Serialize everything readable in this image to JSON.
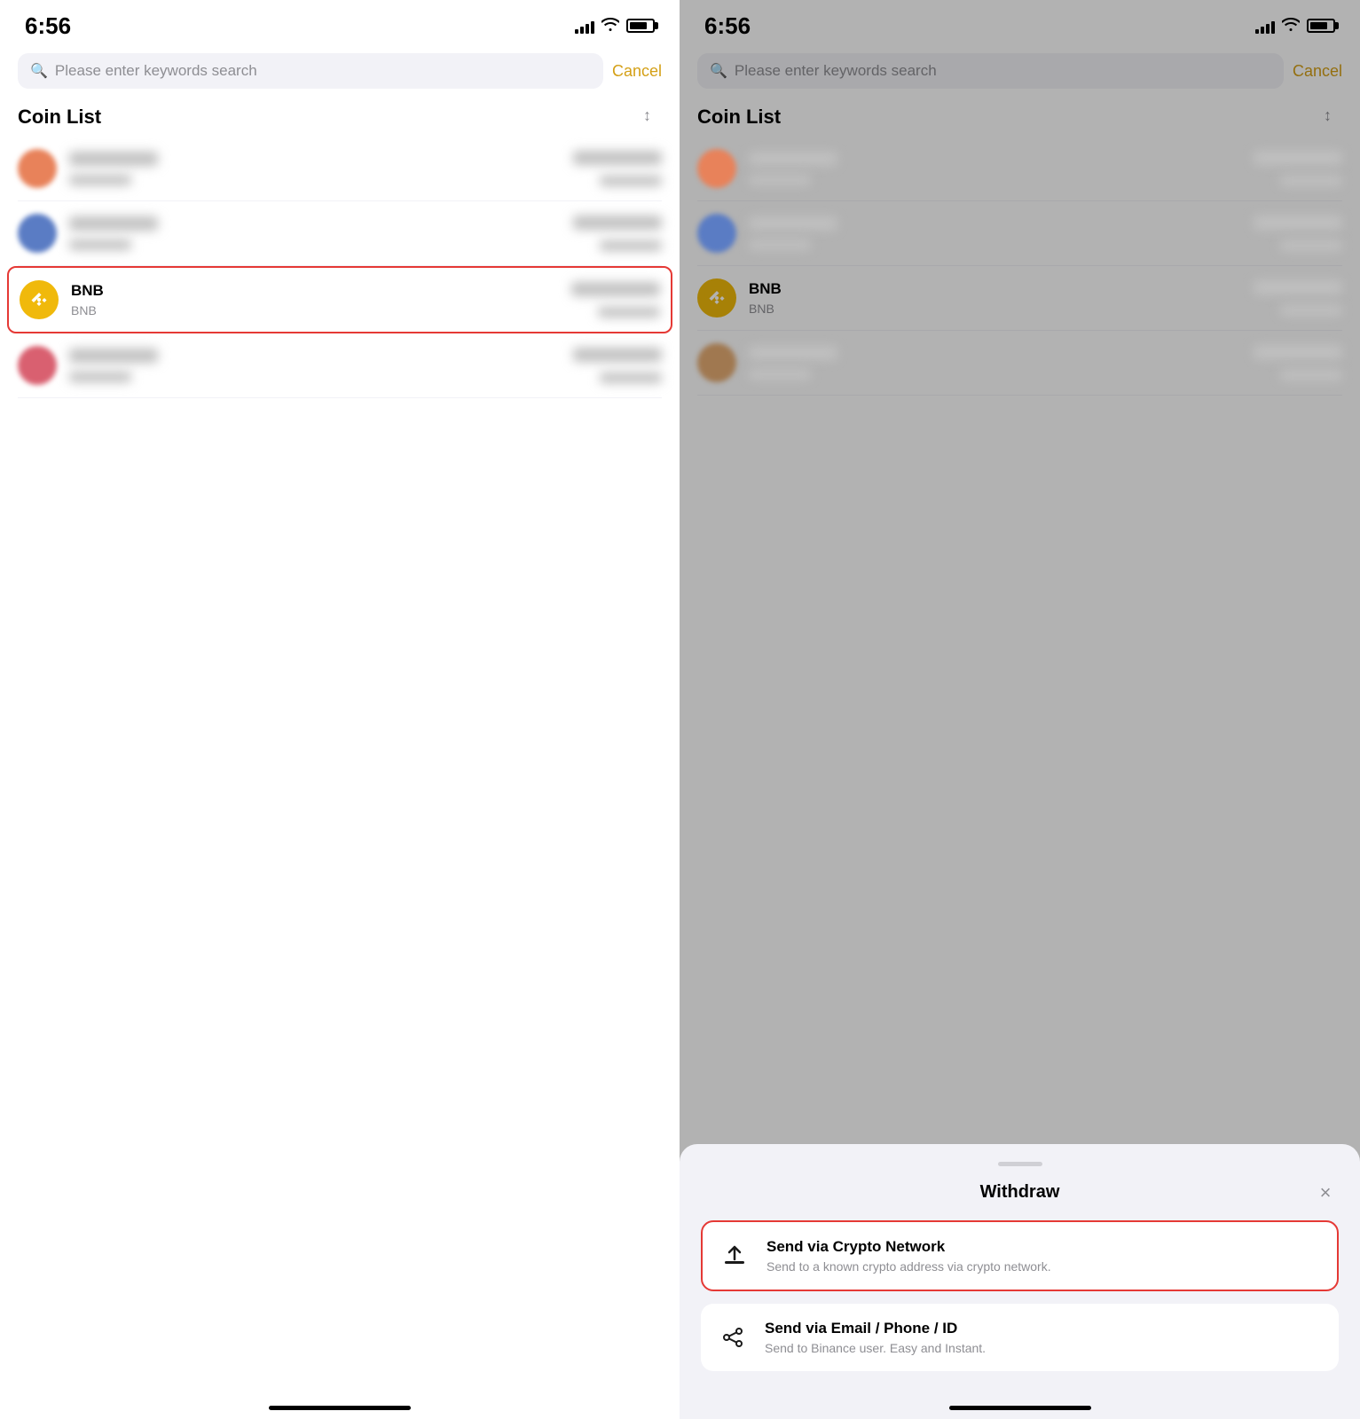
{
  "left_panel": {
    "status": {
      "time": "6:56"
    },
    "search": {
      "placeholder": "Please enter keywords search",
      "cancel_label": "Cancel"
    },
    "section": {
      "title": "Coin List",
      "sort_icon": "↕"
    },
    "coins": [
      {
        "id": "coin1",
        "blurred": true,
        "color": "orange"
      },
      {
        "id": "coin2",
        "blurred": true,
        "color": "blue"
      },
      {
        "id": "bnb",
        "blurred": false,
        "highlighted": true,
        "name": "BNB",
        "symbol": "BNB",
        "icon": "bnb"
      },
      {
        "id": "coin4",
        "blurred": true,
        "color": "pink"
      }
    ]
  },
  "right_panel": {
    "status": {
      "time": "6:56"
    },
    "search": {
      "placeholder": "Please enter keywords search",
      "cancel_label": "Cancel"
    },
    "section": {
      "title": "Coin List",
      "sort_icon": "↕"
    },
    "coins": [
      {
        "id": "coin1",
        "blurred": true,
        "color": "orange"
      },
      {
        "id": "coin2",
        "blurred": true,
        "color": "blue"
      },
      {
        "id": "bnb",
        "blurred": false,
        "highlighted": false,
        "name": "BNB",
        "symbol": "BNB",
        "icon": "bnb"
      },
      {
        "id": "coin4",
        "blurred": true,
        "color": "brown"
      }
    ],
    "bottom_sheet": {
      "title": "Withdraw",
      "close_label": "×",
      "options": [
        {
          "id": "crypto-network",
          "highlighted": true,
          "title": "Send via Crypto Network",
          "desc": "Send to a known crypto address via crypto network.",
          "icon": "upload"
        },
        {
          "id": "email-phone",
          "highlighted": false,
          "title": "Send via Email / Phone / ID",
          "desc": "Send to Binance user. Easy and Instant.",
          "icon": "share"
        }
      ]
    }
  }
}
